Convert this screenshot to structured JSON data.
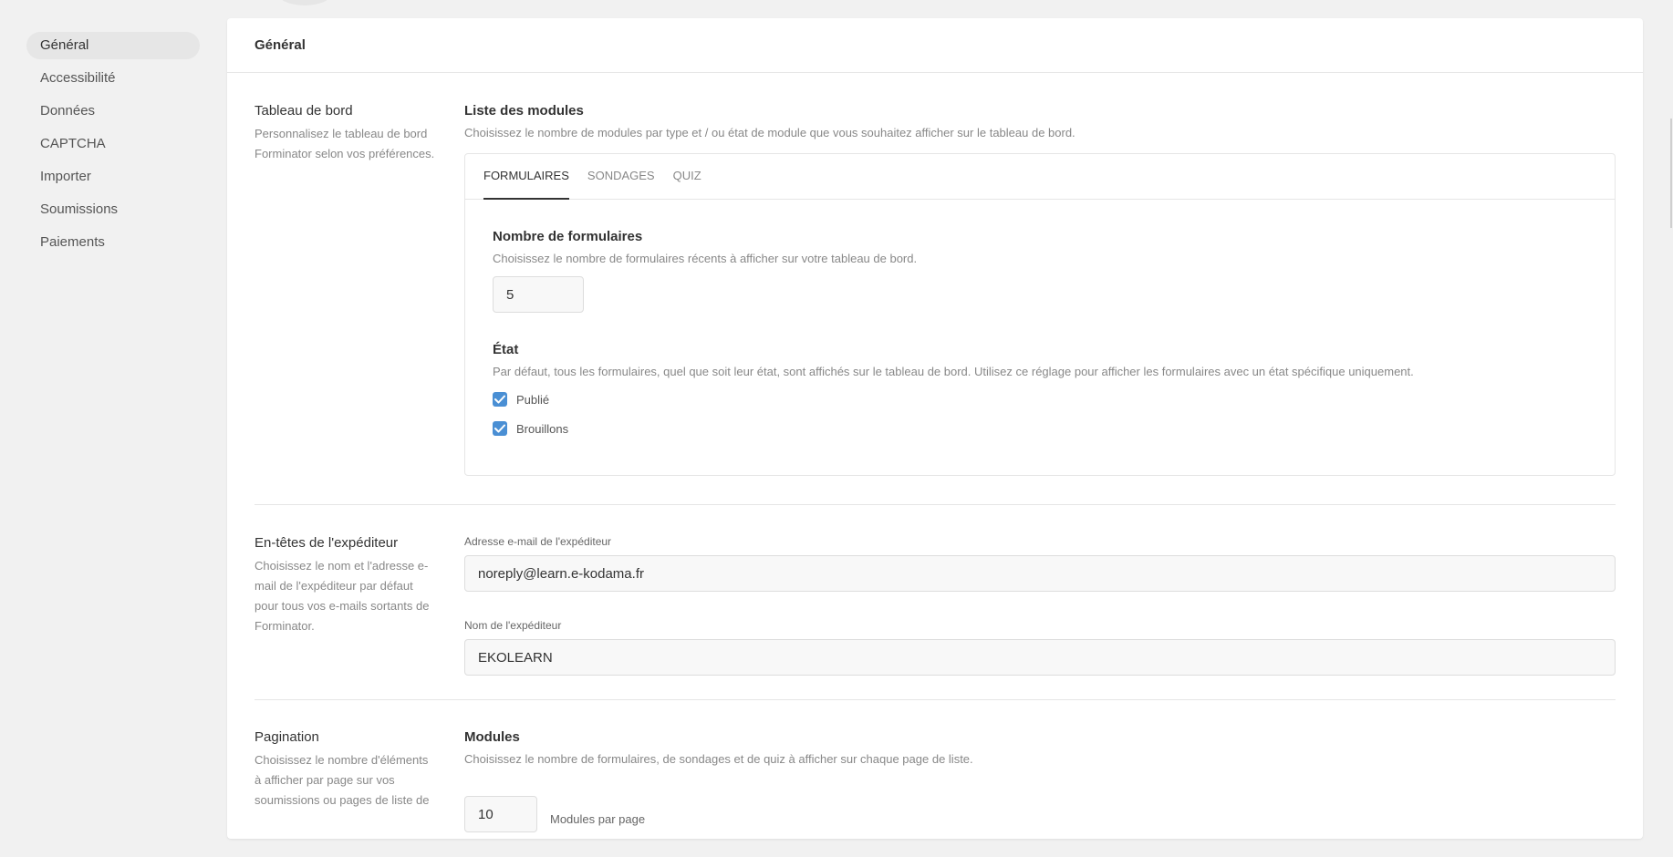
{
  "sidebar": {
    "items": [
      {
        "label": "Général"
      },
      {
        "label": "Accessibilité"
      },
      {
        "label": "Données"
      },
      {
        "label": "CAPTCHA"
      },
      {
        "label": "Importer"
      },
      {
        "label": "Soumissions"
      },
      {
        "label": "Paiements"
      }
    ]
  },
  "panel": {
    "title": "Général"
  },
  "dashboard": {
    "label": "Tableau de bord",
    "description": "Personnalisez le tableau de bord Forminator selon vos préférences.",
    "list_title": "Liste des modules",
    "list_desc": "Choisissez le nombre de modules par type et / ou état de module que vous souhaitez afficher sur le tableau de bord.",
    "tabs": [
      {
        "label": "FORMULAIRES"
      },
      {
        "label": "SONDAGES"
      },
      {
        "label": "QUIZ"
      }
    ],
    "forms_count": {
      "title": "Nombre de formulaires",
      "desc": "Choisissez le nombre de formulaires récents à afficher sur votre tableau de bord.",
      "value": "5"
    },
    "state": {
      "title": "État",
      "desc": "Par défaut, tous les formulaires, quel que soit leur état, sont affichés sur le tableau de bord. Utilisez ce réglage pour afficher les formulaires avec un état spécifique uniquement.",
      "options": [
        {
          "label": "Publié",
          "checked": true
        },
        {
          "label": "Brouillons",
          "checked": true
        }
      ]
    }
  },
  "sender": {
    "label": "En-têtes de l'expéditeur",
    "description": "Choisissez le nom et l'adresse e-mail de l'expéditeur par défaut pour tous vos e-mails sortants de Forminator.",
    "email_label": "Adresse e-mail de l'expéditeur",
    "email_value": "noreply@learn.e-kodama.fr",
    "name_label": "Nom de l'expéditeur",
    "name_value": "EKOLEARN"
  },
  "pagination": {
    "label": "Pagination",
    "description": "Choisissez le nombre d'éléments à afficher par page sur vos soumissions ou pages de liste de",
    "modules_title": "Modules",
    "modules_desc": "Choisissez le nombre de formulaires, de sondages et de quiz à afficher sur chaque page de liste.",
    "modules_value": "10",
    "modules_suffix": "Modules par page"
  },
  "colors": {
    "accent": "#4a8fd4",
    "background": "#f1f1f1",
    "panel": "#ffffff"
  },
  "icons": {
    "checkbox": "check-icon"
  }
}
